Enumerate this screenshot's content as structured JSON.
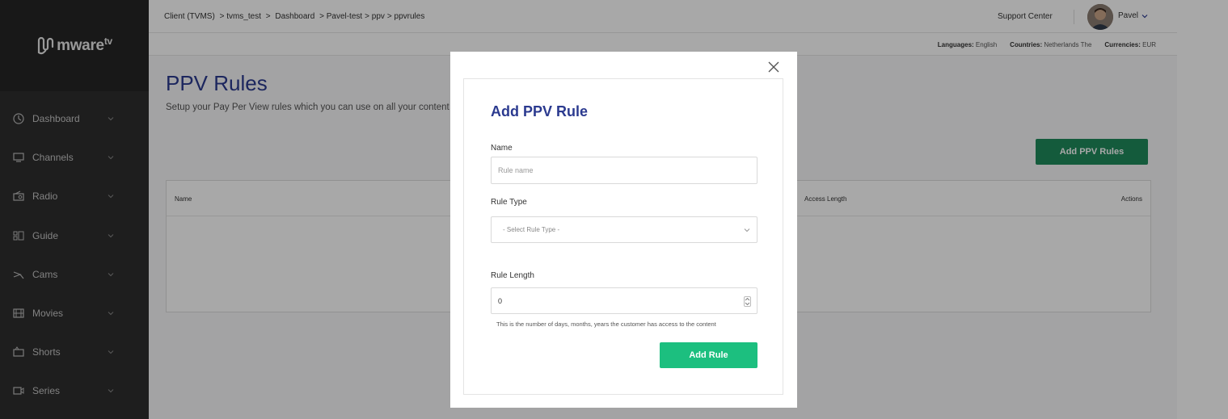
{
  "brand": {
    "name": "mware",
    "suffix": "tv"
  },
  "sidebar": {
    "items": [
      {
        "label": "Dashboard",
        "icon": "dashboard-icon"
      },
      {
        "label": "Channels",
        "icon": "tv-icon"
      },
      {
        "label": "Radio",
        "icon": "radio-icon"
      },
      {
        "label": "Guide",
        "icon": "guide-icon"
      },
      {
        "label": "Cams",
        "icon": "cams-icon"
      },
      {
        "label": "Movies",
        "icon": "film-icon"
      },
      {
        "label": "Shorts",
        "icon": "shorts-icon"
      },
      {
        "label": "Series",
        "icon": "series-icon"
      }
    ]
  },
  "header": {
    "breadcrumb": [
      "Client (TVMS)",
      " > tvms_test",
      " > ",
      "Dashboard",
      " > Pavel-test",
      "> ppv",
      "> ppvrules"
    ],
    "support_label": "Support Center",
    "user_name": "Pavel"
  },
  "meta": {
    "languages_label": "Languages:",
    "languages_value": "English",
    "countries_label": "Countries:",
    "countries_value": "Netherlands The",
    "currencies_label": "Currencies:",
    "currencies_value": "EUR"
  },
  "page": {
    "title": "PPV Rules",
    "subtitle": "Setup your Pay Per View rules which you can use on all your content asse",
    "add_button": "Add PPV Rules",
    "columns": {
      "name": "Name",
      "access_length": "Access Length",
      "actions": "Actions"
    }
  },
  "modal": {
    "title": "Add PPV Rule",
    "name_label": "Name",
    "name_placeholder": "Rule name",
    "type_label": "Rule Type",
    "type_value": "- Select Rule Type -",
    "length_label": "Rule Length",
    "length_value": "0",
    "help_text": "This is the number of days, months, years the customer has access to the content",
    "submit_label": "Add Rule"
  },
  "colors": {
    "accent_blue": "#2b3a8f",
    "primary_green": "#1cbf7f",
    "dark_green": "#1f8a5c",
    "sidebar": "#2e2e2e"
  }
}
